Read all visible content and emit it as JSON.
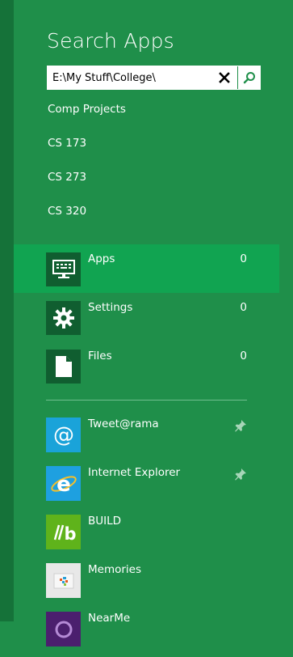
{
  "panel": {
    "title": "Search Apps"
  },
  "search": {
    "value": "E:\\My Stuff\\College\\",
    "clear_icon": "close-icon",
    "submit_icon": "search-icon"
  },
  "suggestions": [
    "Comp Projects",
    "CS 173",
    "CS 273",
    "CS 320"
  ],
  "scopes": [
    {
      "label": "Apps",
      "count": "0",
      "icon": "keyboard-monitor-icon",
      "selected": true
    },
    {
      "label": "Settings",
      "count": "0",
      "icon": "gear-icon",
      "selected": false
    },
    {
      "label": "Files",
      "count": "0",
      "icon": "document-icon",
      "selected": false
    }
  ],
  "apps": [
    {
      "name": "Tweet@rama",
      "icon": "at-sign-icon",
      "pinned": true,
      "color": "#1aa3d9"
    },
    {
      "name": "Internet Explorer",
      "icon": "internet-explorer-icon",
      "pinned": true,
      "color": "#1ea0e0"
    },
    {
      "name": "BUILD",
      "icon": "build-logo-icon",
      "pinned": false,
      "color": "#5fb31b"
    },
    {
      "name": "Memories",
      "icon": "photo-collage-icon",
      "pinned": false,
      "color": "#e8e8e8"
    },
    {
      "name": "NearMe",
      "icon": "nearme-icon",
      "pinned": false,
      "color": "#4b1f6e"
    }
  ],
  "colors": {
    "pane": "#1f8f4a",
    "left_strip": "#157239",
    "selected_row": "#11a451",
    "scope_tile": "#105e30"
  }
}
